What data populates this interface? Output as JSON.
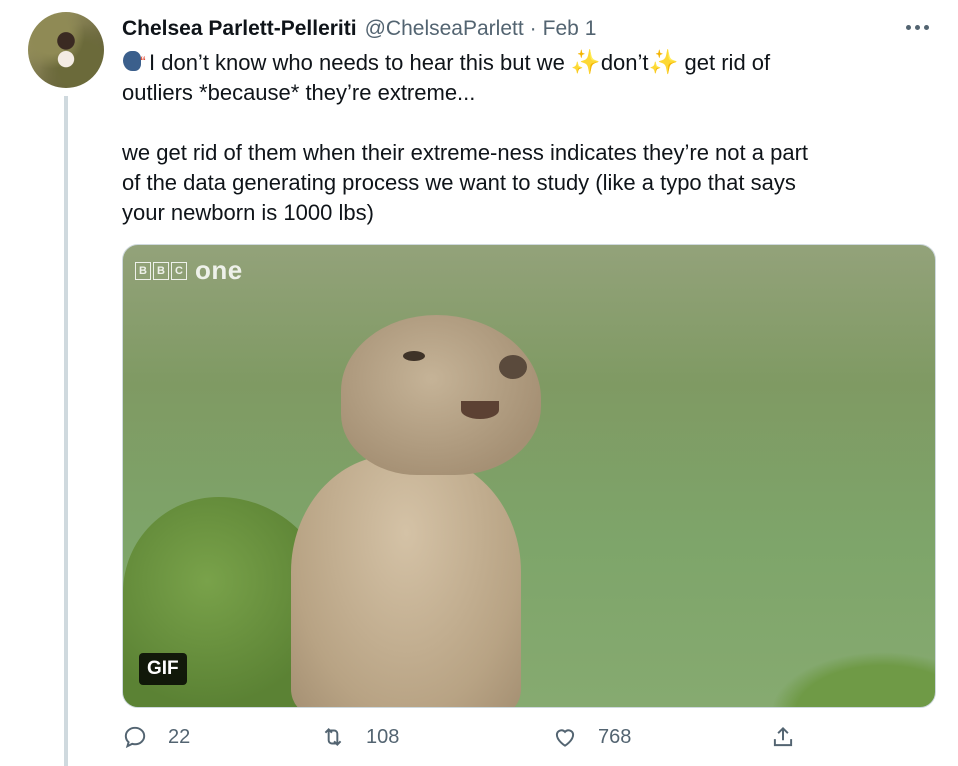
{
  "tweet": {
    "author_name": "Chelsea Parlett-Pelleriti",
    "handle": "@ChelseaParlett",
    "separator": "·",
    "date": "Feb 1",
    "text": {
      "line1_pre": "I don’t know who needs to hear this but we ",
      "sparkle": "✨",
      "dont": "don’t",
      "line1_post": " get rid of",
      "line2": "outliers *because* they’re extreme...",
      "para2_line1": "we get rid of them when their extreme-ness indicates they’re not a part",
      "para2_line2": "of the data generating process we want to study (like a typo that says",
      "para2_line3": "your newborn is 1000 lbs)"
    },
    "media": {
      "badge": "GIF",
      "watermark_letters": [
        "B",
        "B",
        "C"
      ],
      "watermark_word": "one"
    },
    "actions": {
      "reply_count": "22",
      "retweet_count": "108",
      "like_count": "768"
    }
  },
  "icons": {
    "reply": "reply-icon",
    "retweet": "retweet-icon",
    "like": "heart-icon",
    "share": "share-icon",
    "more": "more-icon",
    "speaker": "speaking-head-icon"
  }
}
